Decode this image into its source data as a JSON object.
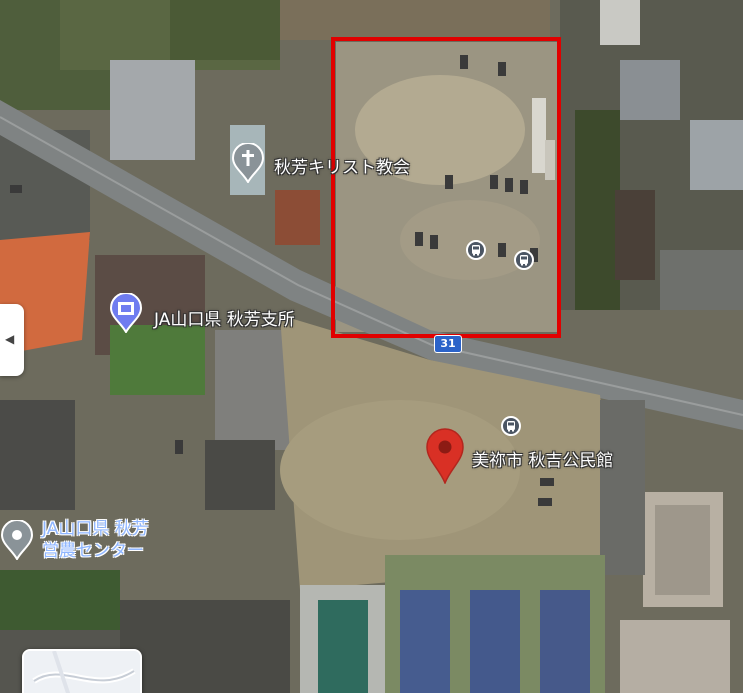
{
  "map": {
    "places": [
      {
        "name": "秋芳キリスト教会",
        "icon": "church-icon"
      },
      {
        "name": "JA山口県 秋芳支所",
        "icon": "bank-building-icon"
      },
      {
        "name": "美祢市 秋吉公民館",
        "icon": "red-location-pin-icon"
      },
      {
        "name": "JA山口県 秋芳\n営農センター",
        "icon": "gray-location-pin-icon"
      }
    ],
    "route_number": "31",
    "transit_icon": "bus-icon",
    "highlight_color": "#e10000",
    "pin_color": "#d93025"
  },
  "ui": {
    "side_toggle_icon": "chevron-left-icon",
    "layer_thumbnail": "map-layer-thumbnail"
  }
}
